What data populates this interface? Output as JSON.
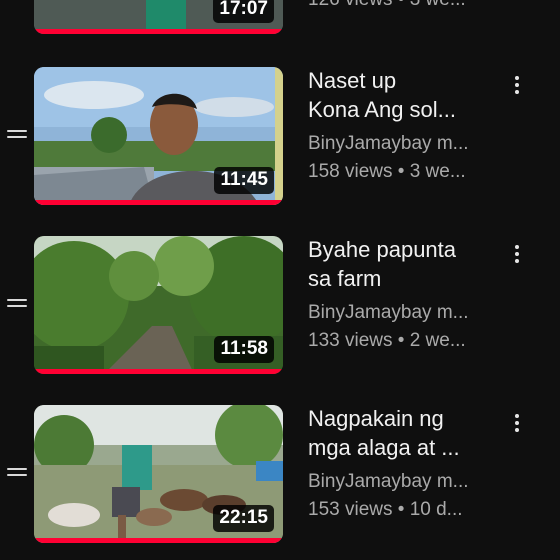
{
  "playlist": {
    "partial_top": {
      "duration": "17:07",
      "meta": "126 views • 3 we..."
    },
    "items": [
      {
        "title_line1": "Naset up",
        "title_line2": "Kona Ang sol...",
        "channel": "BinyJamaybay m...",
        "stats": "158 views • 3 we...",
        "duration": "11:45"
      },
      {
        "title_line1": "Byahe papunta",
        "title_line2": "sa farm",
        "channel": "BinyJamaybay m...",
        "stats": "133 views • 2 we...",
        "duration": "11:58"
      },
      {
        "title_line1": "Nagpakain ng",
        "title_line2": "mga alaga at ...",
        "channel": "BinyJamaybay m...",
        "stats": "153 views • 10 d...",
        "duration": "22:15"
      }
    ],
    "colors": {
      "background": "#0f0f0f",
      "progress": "#ff0033",
      "secondary_text": "#aaaaaa"
    },
    "icons": {
      "drag": "drag-handle-icon",
      "menu": "more-vert-icon"
    }
  }
}
